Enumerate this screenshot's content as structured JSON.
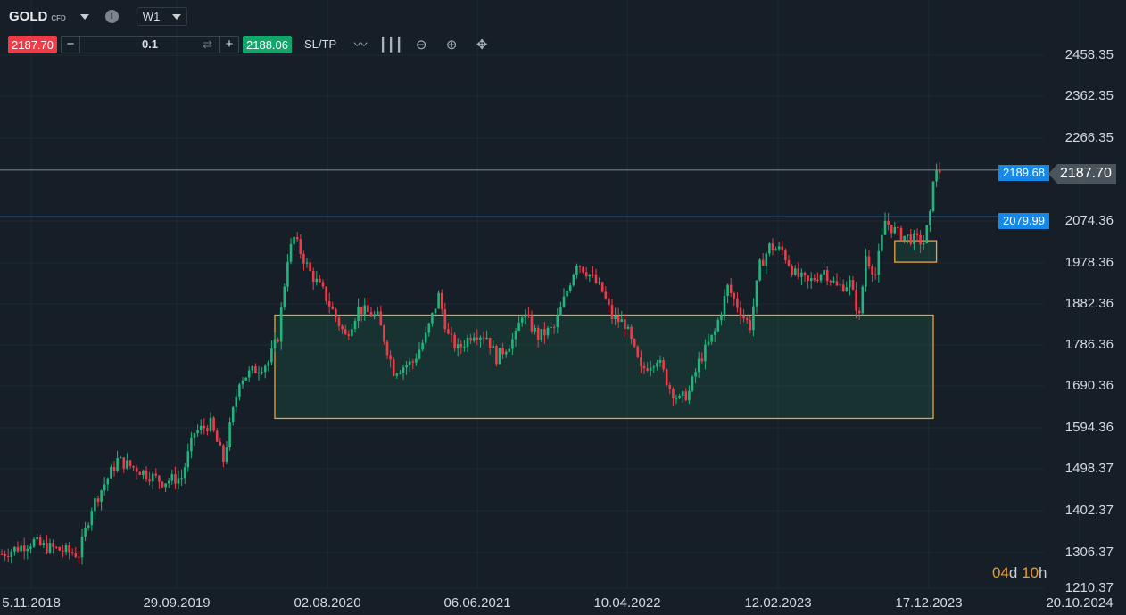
{
  "header": {
    "symbol": "GOLD",
    "symbol_type": "CFD",
    "timeframe": "W1",
    "info_icon": "i"
  },
  "trade": {
    "sell_price": "2187.70",
    "buy_price": "2188.06",
    "quantity": "0.1",
    "minus": "−",
    "plus": "+",
    "sltp_label": "SL/TP"
  },
  "tools": [
    "line-chart-icon",
    "candlestick-icon",
    "zoom-out-icon",
    "zoom-in-icon",
    "move-icon"
  ],
  "price_axis": [
    "2458.35",
    "2362.35",
    "2266.35",
    "2074.36",
    "1978.36",
    "1882.36",
    "1786.36",
    "1690.36",
    "1594.36",
    "1498.37",
    "1402.37",
    "1306.37",
    "1210.37"
  ],
  "time_axis": [
    "5.11.2018",
    "29.09.2019",
    "02.08.2020",
    "06.06.2021",
    "10.04.2022",
    "12.02.2023",
    "17.12.2023",
    "20.10.2024"
  ],
  "levels": {
    "upper": "2189.68",
    "lower": "2079.99",
    "current": "2187.70"
  },
  "countdown": {
    "days": "04",
    "d": "d",
    "hours": "10",
    "h": "h"
  },
  "colors": {
    "bg": "#161f27",
    "up": "#1fb57c",
    "down": "#ef3b48",
    "level": "#1588e8",
    "zone": "#e8a33a"
  },
  "chart_data": {
    "type": "candlestick",
    "instrument": "GOLD CFD",
    "timeframe": "W1",
    "ylim": [
      1210.37,
      2458.35
    ],
    "path_week_close": [
      [
        0,
        1290
      ],
      [
        10,
        1320
      ],
      [
        12,
        1310
      ],
      [
        24,
        1290
      ],
      [
        28,
        1400
      ],
      [
        36,
        1510
      ],
      [
        42,
        1490
      ],
      [
        50,
        1460
      ],
      [
        56,
        1470
      ],
      [
        60,
        1575
      ],
      [
        65,
        1595
      ],
      [
        69,
        1510
      ],
      [
        74,
        1700
      ],
      [
        83,
        1740
      ],
      [
        86,
        1800
      ],
      [
        89,
        1985
      ],
      [
        91,
        2030
      ],
      [
        96,
        1950
      ],
      [
        100,
        1905
      ],
      [
        107,
        1800
      ],
      [
        111,
        1865
      ],
      [
        117,
        1845
      ],
      [
        122,
        1720
      ],
      [
        128,
        1740
      ],
      [
        132,
        1800
      ],
      [
        136,
        1895
      ],
      [
        139,
        1800
      ],
      [
        142,
        1770
      ],
      [
        147,
        1810
      ],
      [
        151,
        1800
      ],
      [
        154,
        1750
      ],
      [
        160,
        1800
      ],
      [
        162,
        1855
      ],
      [
        167,
        1800
      ],
      [
        172,
        1820
      ],
      [
        175,
        1885
      ],
      [
        179,
        1975
      ],
      [
        183,
        1945
      ],
      [
        187,
        1905
      ],
      [
        190,
        1845
      ],
      [
        194,
        1830
      ],
      [
        199,
        1720
      ],
      [
        204,
        1750
      ],
      [
        208,
        1680
      ],
      [
        211,
        1650
      ],
      [
        214,
        1670
      ],
      [
        217,
        1740
      ],
      [
        222,
        1810
      ],
      [
        226,
        1915
      ],
      [
        231,
        1845
      ],
      [
        233,
        1825
      ],
      [
        236,
        1965
      ],
      [
        239,
        2010
      ],
      [
        243,
        2000
      ],
      [
        247,
        1945
      ],
      [
        251,
        1925
      ],
      [
        256,
        1955
      ],
      [
        260,
        1915
      ],
      [
        264,
        1925
      ],
      [
        267,
        1845
      ],
      [
        269,
        1990
      ],
      [
        272,
        1945
      ],
      [
        275,
        2070
      ],
      [
        279,
        2040
      ],
      [
        283,
        2030
      ],
      [
        287,
        2020
      ],
      [
        289,
        2080
      ],
      [
        290,
        2175
      ],
      [
        292,
        2188
      ]
    ],
    "zones": [
      {
        "top": 1850,
        "bottom": 1608,
        "from_week": 85,
        "to_week": 290
      },
      {
        "top": 2024,
        "bottom": 1974,
        "from_week": 278,
        "to_week": 291
      }
    ],
    "hlines": [
      2189.68,
      2079.99
    ]
  }
}
